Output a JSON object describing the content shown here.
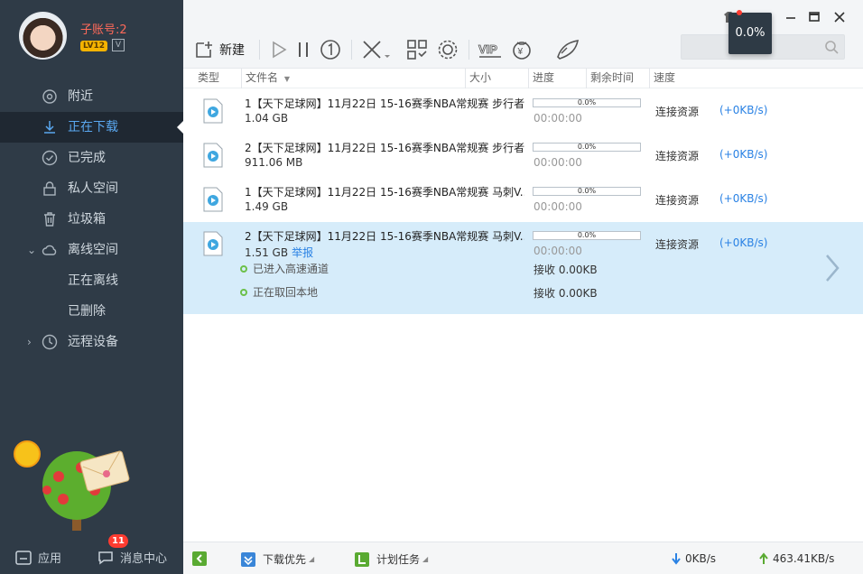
{
  "profile": {
    "username": "子账号:2",
    "level": "LV12",
    "vip_mark": "V"
  },
  "nav": [
    {
      "label": "附近",
      "icon": "location-icon"
    },
    {
      "label": "正在下载",
      "icon": "download-icon",
      "active": true
    },
    {
      "label": "已完成",
      "icon": "check-circle-icon"
    },
    {
      "label": "私人空间",
      "icon": "lock-icon"
    },
    {
      "label": "垃圾箱",
      "icon": "trash-icon"
    },
    {
      "label": "离线空间",
      "icon": "cloud-icon",
      "expanded": true
    },
    {
      "label": "正在离线",
      "icon": "",
      "child": true
    },
    {
      "label": "已删除",
      "icon": "",
      "child": true
    },
    {
      "label": "远程设备",
      "icon": "remote-icon",
      "collapsed": true
    }
  ],
  "sidebar_bottom": {
    "apps_label": "应用",
    "messages_label": "消息中心",
    "message_count": "11"
  },
  "toolbar": {
    "new_label": "新建",
    "tooltip": "0.0%",
    "search_placeholder": ""
  },
  "columns": [
    "类型",
    "文件名",
    "大小",
    "进度",
    "剩余时间",
    "速度"
  ],
  "downloads": [
    {
      "name": "1【天下足球网】11月22日 15-16赛季NBA常规赛 步行者...",
      "size": "1.04 GB",
      "progress_label": "0.0%",
      "progress": 0.0,
      "time_left": "00:00:00",
      "status": "连接资源",
      "speed": "(+0KB/s)"
    },
    {
      "name": "2【天下足球网】11月22日 15-16赛季NBA常规赛 步行者...",
      "size": "911.06 MB",
      "progress_label": "0.0%",
      "progress": 0.0,
      "time_left": "00:00:00",
      "status": "连接资源",
      "speed": "(+0KB/s)"
    },
    {
      "name": "1【天下足球网】11月22日 15-16赛季NBA常规赛 马刺V...",
      "size": "1.49 GB",
      "progress_label": "0.0%",
      "progress": 0.0,
      "time_left": "00:00:00",
      "status": "连接资源",
      "speed": "(+0KB/s)"
    },
    {
      "name": "2【天下足球网】11月22日 15-16赛季NBA常规赛 马刺V...",
      "size": "1.51 GB",
      "report_label": "举报",
      "progress_label": "0.0%",
      "progress": 0.0,
      "time_left": "00:00:00",
      "status": "连接资源",
      "speed": "(+0KB/s)",
      "details": [
        {
          "label": "已进入高速通道",
          "recv": "接收 0.00KB"
        },
        {
          "label": "正在取回本地",
          "recv": "接收 0.00KB"
        }
      ]
    }
  ],
  "bottom": {
    "priority_label": "下载优先",
    "plan_label": "计划任务",
    "down_rate": "0KB/s",
    "up_rate": "463.41KB/s"
  },
  "colors": {
    "sidebar": "#2f3b47",
    "accent": "#2a82e4",
    "selected_row": "#d6ecfa"
  }
}
